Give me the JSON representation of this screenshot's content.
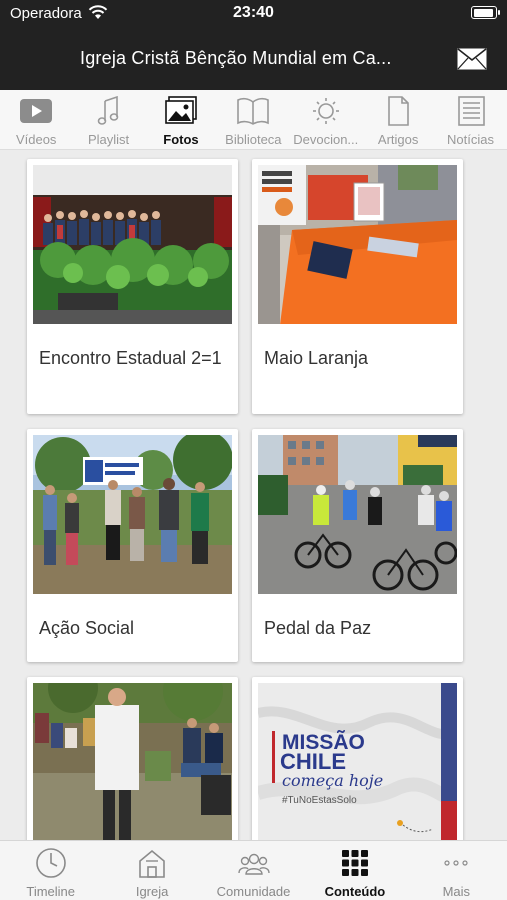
{
  "status_bar": {
    "carrier": "Operadora",
    "time": "23:40"
  },
  "header": {
    "title": "Igreja Cristã Bênção Mundial em Ca..."
  },
  "tabs": [
    {
      "label": "Vídeos",
      "icon": "video-icon"
    },
    {
      "label": "Playlist",
      "icon": "music-note-icon"
    },
    {
      "label": "Fotos",
      "icon": "photos-icon"
    },
    {
      "label": "Biblioteca",
      "icon": "book-icon"
    },
    {
      "label": "Devocion...",
      "icon": "sun-icon"
    },
    {
      "label": "Artigos",
      "icon": "document-icon"
    },
    {
      "label": "Notícias",
      "icon": "news-icon"
    }
  ],
  "active_tab": "Fotos",
  "albums": [
    {
      "title": "Encontro Estadual 2=1"
    },
    {
      "title": "Maio Laranja"
    },
    {
      "title": "Ação Social"
    },
    {
      "title": "Pedal da Paz"
    },
    {
      "title": ""
    },
    {
      "title": "",
      "image_text": {
        "line1": "MISSÃO",
        "line2": "CHILE",
        "line3": "começa hoje",
        "hashtag": "#TuNoEstasSolo"
      }
    }
  ],
  "bottom_nav": [
    {
      "label": "Timeline",
      "icon": "clock-icon"
    },
    {
      "label": "Igreja",
      "icon": "church-icon"
    },
    {
      "label": "Comunidade",
      "icon": "people-icon"
    },
    {
      "label": "Conteúdo",
      "icon": "grid-icon"
    },
    {
      "label": "Mais",
      "icon": "more-icon"
    }
  ],
  "active_bottom": "Conteúdo",
  "colors": {
    "header_bg": "#222222",
    "accent": "#111111",
    "inactive": "#999999",
    "missao_blue": "#2b3a8c",
    "missao_red": "#c0282d"
  }
}
